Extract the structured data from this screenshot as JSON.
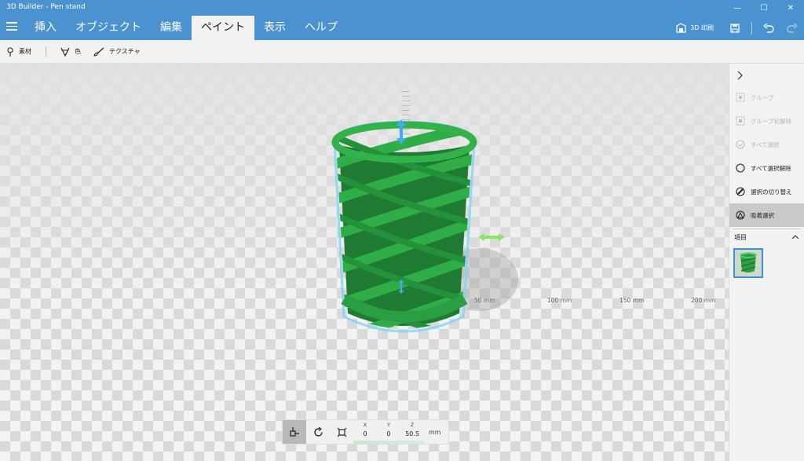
{
  "window": {
    "title": "3D Builder - Pen stand",
    "controls": {
      "minimize": "—",
      "maximize": "☐",
      "close": "✕"
    }
  },
  "menu": {
    "tabs": [
      {
        "label": "挿入"
      },
      {
        "label": "オブジェクト"
      },
      {
        "label": "編集"
      },
      {
        "label": "ペイント"
      },
      {
        "label": "表示"
      },
      {
        "label": "ヘルプ"
      }
    ],
    "active_tab": "ペイント",
    "print_label": "3D 印刷"
  },
  "toolbar": {
    "material_label": "素材",
    "color_label": "色",
    "texture_label": "テクスチャ"
  },
  "viewport": {
    "floor_labels": [
      "50 mm",
      "100 mm",
      "150 mm",
      "200 mm"
    ],
    "model_color": "#2ea043",
    "highlight_color": "#53c1f0",
    "arrow_color": "#3aaef0",
    "x_arrow_color": "#8fe16a"
  },
  "transform": {
    "x_label": "X",
    "x_value": "0",
    "y_label": "Y",
    "y_value": "0",
    "z_label": "Z",
    "z_value": "50.5",
    "unit": "mm"
  },
  "right_panel": {
    "items": [
      {
        "label": "グループ",
        "icon": "group-icon",
        "enabled": false
      },
      {
        "label": "グループ化解除",
        "icon": "ungroup-icon",
        "enabled": false
      },
      {
        "label": "すべて選択",
        "icon": "select-all-icon",
        "enabled": false
      },
      {
        "label": "すべて選択解除",
        "icon": "deselect-all-icon",
        "enabled": true
      },
      {
        "label": "選択の切り替え",
        "icon": "toggle-selection-icon",
        "enabled": true
      },
      {
        "label": "吸着選択",
        "icon": "magnet-select-icon",
        "enabled": true,
        "active": true
      }
    ],
    "section_title": "項目"
  }
}
